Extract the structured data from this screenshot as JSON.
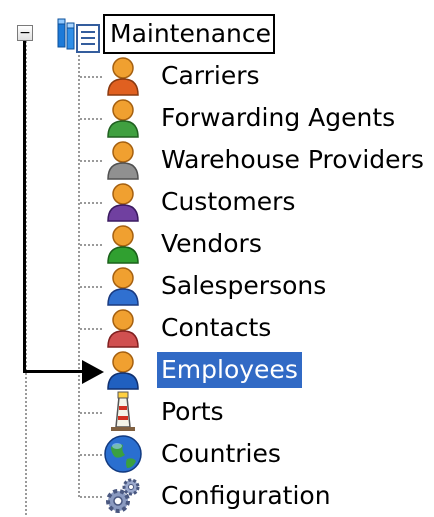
{
  "tree": {
    "root": {
      "label": "Maintenance",
      "expander": "−",
      "icon": "folder-list-icon"
    },
    "items": [
      {
        "label": "Carriers",
        "icon": "person-icon",
        "selected": false
      },
      {
        "label": "Forwarding Agents",
        "icon": "person-icon",
        "selected": false
      },
      {
        "label": "Warehouse Providers",
        "icon": "person-icon",
        "selected": false
      },
      {
        "label": "Customers",
        "icon": "person-icon",
        "selected": false
      },
      {
        "label": "Vendors",
        "icon": "person-icon",
        "selected": false
      },
      {
        "label": "Salespersons",
        "icon": "person-icon",
        "selected": false
      },
      {
        "label": "Contacts",
        "icon": "person-icon",
        "selected": false
      },
      {
        "label": "Employees",
        "icon": "person-icon",
        "selected": true
      },
      {
        "label": "Ports",
        "icon": "lighthouse-icon",
        "selected": false
      },
      {
        "label": "Countries",
        "icon": "globe-icon",
        "selected": false
      },
      {
        "label": "Configuration",
        "icon": "gears-icon",
        "selected": false
      }
    ]
  },
  "colors": {
    "selection": "#316ac5",
    "selected_text": "#ffffff",
    "person_head": "#f0a030",
    "person_bodies": [
      "#e06020",
      "#40a040",
      "#909090",
      "#7040a0",
      "#30a030",
      "#3070d0",
      "#d05050",
      "#2060c0"
    ]
  }
}
